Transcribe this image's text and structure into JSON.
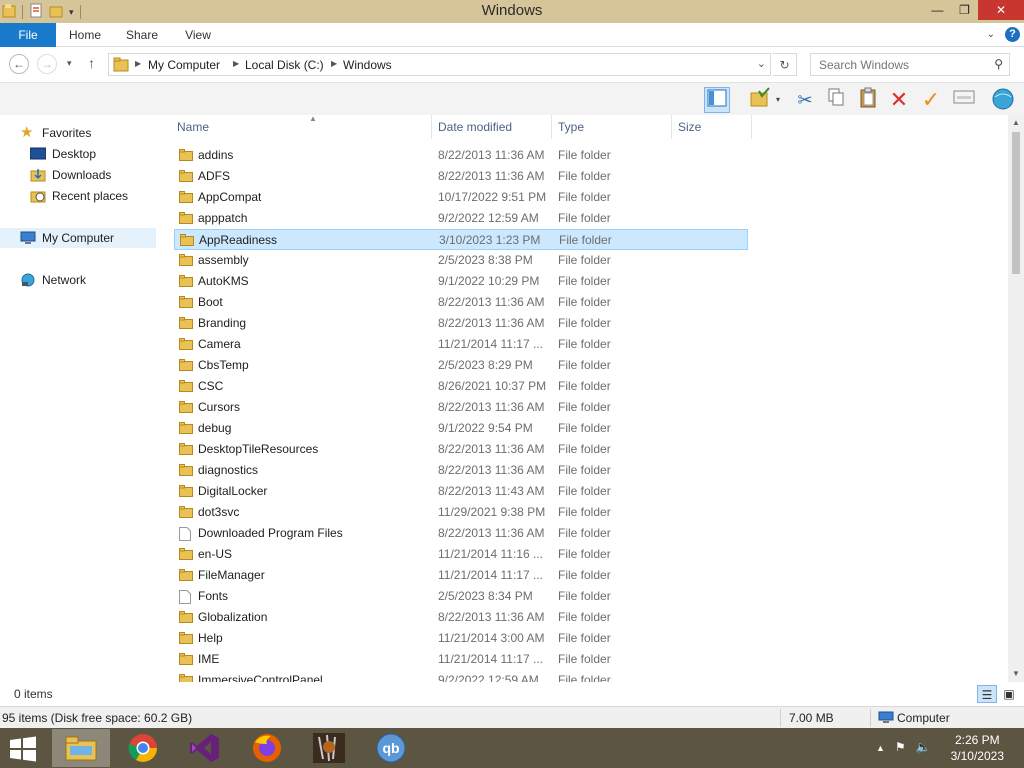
{
  "window": {
    "title": "Windows"
  },
  "ribbon": {
    "tabs": [
      {
        "label": "File"
      },
      {
        "label": "Home"
      },
      {
        "label": "Share"
      },
      {
        "label": "View"
      }
    ],
    "help_label": "?"
  },
  "address": {
    "crumbs": [
      "My Computer",
      "Local Disk (C:)",
      "Windows"
    ]
  },
  "search": {
    "placeholder": "Search Windows"
  },
  "nav": {
    "favorites": "Favorites",
    "desktop": "Desktop",
    "downloads": "Downloads",
    "recent": "Recent places",
    "computer": "My Computer",
    "network": "Network"
  },
  "columns": {
    "name": "Name",
    "date": "Date modified",
    "type": "Type",
    "size": "Size"
  },
  "files": [
    {
      "name": "addins",
      "date": "8/22/2013 11:36 AM",
      "type": "File folder",
      "kind": "folder"
    },
    {
      "name": "ADFS",
      "date": "8/22/2013 11:36 AM",
      "type": "File folder",
      "kind": "folder"
    },
    {
      "name": "AppCompat",
      "date": "10/17/2022 9:51 PM",
      "type": "File folder",
      "kind": "folder"
    },
    {
      "name": "apppatch",
      "date": "9/2/2022 12:59 AM",
      "type": "File folder",
      "kind": "folder"
    },
    {
      "name": "AppReadiness",
      "date": "3/10/2023 1:23 PM",
      "type": "File folder",
      "kind": "folder",
      "selected": true
    },
    {
      "name": "assembly",
      "date": "2/5/2023 8:38 PM",
      "type": "File folder",
      "kind": "folder"
    },
    {
      "name": "AutoKMS",
      "date": "9/1/2022 10:29 PM",
      "type": "File folder",
      "kind": "folder"
    },
    {
      "name": "Boot",
      "date": "8/22/2013 11:36 AM",
      "type": "File folder",
      "kind": "folder"
    },
    {
      "name": "Branding",
      "date": "8/22/2013 11:36 AM",
      "type": "File folder",
      "kind": "folder"
    },
    {
      "name": "Camera",
      "date": "11/21/2014 11:17 ...",
      "type": "File folder",
      "kind": "folder"
    },
    {
      "name": "CbsTemp",
      "date": "2/5/2023 8:29 PM",
      "type": "File folder",
      "kind": "folder"
    },
    {
      "name": "CSC",
      "date": "8/26/2021 10:37 PM",
      "type": "File folder",
      "kind": "folder"
    },
    {
      "name": "Cursors",
      "date": "8/22/2013 11:36 AM",
      "type": "File folder",
      "kind": "folder"
    },
    {
      "name": "debug",
      "date": "9/1/2022 9:54 PM",
      "type": "File folder",
      "kind": "folder"
    },
    {
      "name": "DesktopTileResources",
      "date": "8/22/2013 11:36 AM",
      "type": "File folder",
      "kind": "folder"
    },
    {
      "name": "diagnostics",
      "date": "8/22/2013 11:36 AM",
      "type": "File folder",
      "kind": "folder"
    },
    {
      "name": "DigitalLocker",
      "date": "8/22/2013 11:43 AM",
      "type": "File folder",
      "kind": "folder"
    },
    {
      "name": "dot3svc",
      "date": "11/29/2021 9:38 PM",
      "type": "File folder",
      "kind": "folder"
    },
    {
      "name": "Downloaded Program Files",
      "date": "8/22/2013 11:36 AM",
      "type": "File folder",
      "kind": "special"
    },
    {
      "name": "en-US",
      "date": "11/21/2014 11:16 ...",
      "type": "File folder",
      "kind": "folder"
    },
    {
      "name": "FileManager",
      "date": "11/21/2014 11:17 ...",
      "type": "File folder",
      "kind": "folder"
    },
    {
      "name": "Fonts",
      "date": "2/5/2023 8:34 PM",
      "type": "File folder",
      "kind": "special"
    },
    {
      "name": "Globalization",
      "date": "8/22/2013 11:36 AM",
      "type": "File folder",
      "kind": "folder"
    },
    {
      "name": "Help",
      "date": "11/21/2014 3:00 AM",
      "type": "File folder",
      "kind": "folder"
    },
    {
      "name": "IME",
      "date": "11/21/2014 11:17 ...",
      "type": "File folder",
      "kind": "folder"
    },
    {
      "name": "ImmersiveControlPanel",
      "date": "9/2/2022 12:59 AM",
      "type": "File folder",
      "kind": "folder"
    }
  ],
  "status": {
    "selected_count": "0 items",
    "summary": "95 items (Disk free space: 60.2 GB)",
    "size": "7.00 MB",
    "location": "Computer"
  },
  "taskbar": {
    "time": "2:26 PM",
    "date": "3/10/2023",
    "apps": [
      "file-explorer",
      "chrome",
      "visual-studio",
      "firefox",
      "wolverine-game",
      "qbittorrent"
    ]
  },
  "colors": {
    "titlebar": "#d7c59a",
    "file_tab": "#1979ca",
    "selection": "#cce8ff",
    "taskbar": "#5c5542",
    "folder": "#e8c255"
  }
}
